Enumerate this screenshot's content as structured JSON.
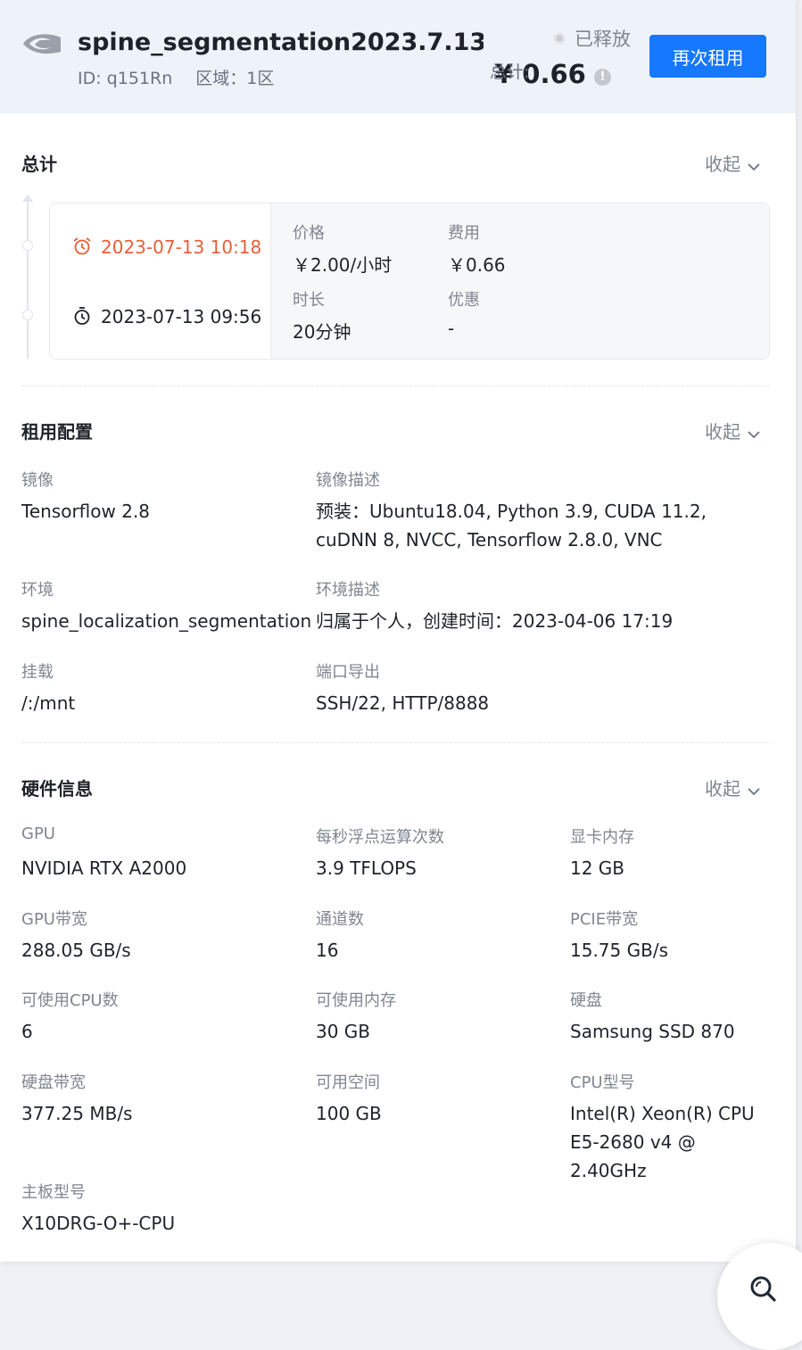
{
  "header": {
    "title": "spine_segmentation2023.7.13-t...",
    "id_text": "ID: q151Rn",
    "region_text": "区域：1区",
    "status": "已释放",
    "total_label": "总计:",
    "total_amount": "¥ 0.66",
    "info_icon": "!",
    "rerent_button": "再次租用"
  },
  "summary": {
    "title": "总计",
    "collapse_label": "收起",
    "end_time": "2023-07-13 10:18",
    "start_time": "2023-07-13 09:56",
    "price_label": "价格",
    "price_value": "￥2.00/小时",
    "cost_label": "费用",
    "cost_value": "￥0.66",
    "duration_label": "时长",
    "duration_value": "20分钟",
    "discount_label": "优惠",
    "discount_value": "-"
  },
  "config": {
    "title": "租用配置",
    "collapse_label": "收起",
    "image_label": "镜像",
    "image_value": "Tensorflow 2.8",
    "image_desc_label": "镜像描述",
    "image_desc_value": "预装：Ubuntu18.04, Python 3.9, CUDA 11.2, cuDNN 8, NVCC, Tensorflow 2.8.0, VNC",
    "env_label": "环境",
    "env_value": "spine_localization_segmentation",
    "env_desc_label": "环境描述",
    "env_desc_value": "归属于个人，创建时间：2023-04-06 17:19",
    "mount_label": "挂载",
    "mount_value": "/:/mnt",
    "ports_label": "端口导出",
    "ports_value": "SSH/22, HTTP/8888"
  },
  "hardware": {
    "title": "硬件信息",
    "collapse_label": "收起",
    "gpu_label": "GPU",
    "gpu_value": "NVIDIA RTX A2000",
    "flops_label": "每秒浮点运算次数",
    "flops_value": "3.9 TFLOPS",
    "vram_label": "显卡内存",
    "vram_value": "12 GB",
    "gpu_bw_label": "GPU带宽",
    "gpu_bw_value": "288.05 GB/s",
    "channels_label": "通道数",
    "channels_value": "16",
    "pcie_label": "PCIE带宽",
    "pcie_value": "15.75 GB/s",
    "cpu_count_label": "可使用CPU数",
    "cpu_count_value": "6",
    "mem_label": "可使用内存",
    "mem_value": "30 GB",
    "disk_label": "硬盘",
    "disk_value": "Samsung SSD 870",
    "disk_bw_label": "硬盘带宽",
    "disk_bw_value": "377.25 MB/s",
    "space_label": "可用空间",
    "space_value": "100 GB",
    "cpu_model_label": "CPU型号",
    "cpu_model_value": "Intel(R) Xeon(R) CPU E5-2680 v4 @ 2.40GHz",
    "board_label": "主板型号",
    "board_value": "X10DRG-O+-CPU"
  },
  "colors": {
    "accent": "#1677ff",
    "end_time": "#e5603a",
    "header_bg": "#eef2f9"
  },
  "icons": [
    "nvidia-logo-icon",
    "status-dot-icon",
    "info-icon",
    "chevron-down-icon",
    "alarm-clock-icon",
    "stopwatch-icon",
    "search-icon"
  ]
}
